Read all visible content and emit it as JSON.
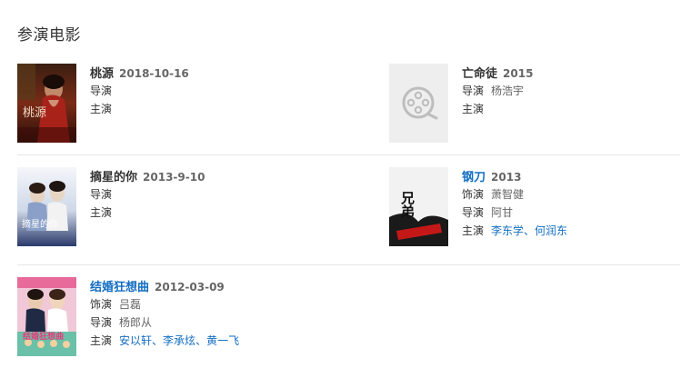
{
  "section_title": "参演电影",
  "movies": [
    {
      "title": "桃源",
      "date": "2018-10-16",
      "director_label": "导演",
      "starring_label": "主演"
    },
    {
      "title": "亡命徒",
      "date": "2015",
      "director_label": "导演",
      "director": "杨浩宇",
      "starring_label": "主演"
    },
    {
      "title": "摘星的你",
      "date": "2013-9-10",
      "director_label": "导演",
      "starring_label": "主演"
    },
    {
      "title": "钢刀",
      "date": "2013",
      "role_label": "饰演",
      "role": "萧智健",
      "director_label": "导演",
      "director": "阿甘",
      "starring_label": "主演",
      "stars": [
        "李东学",
        "何润东"
      ]
    },
    {
      "title": "结婚狂想曲",
      "date": "2012-03-09",
      "role_label": "饰演",
      "role": "吕磊",
      "director_label": "导演",
      "director": "杨郎从",
      "starring_label": "主演",
      "stars": [
        "安以轩",
        "李承炫",
        "黄一飞"
      ]
    }
  ],
  "poster_texts": {
    "taoyuan": "桃源",
    "zhaixing": "摘星的你",
    "gangdao": "兄弟",
    "jiehun": "结婚狂想曲"
  },
  "separator": "、",
  "colors": {
    "link": "#136ec2",
    "label": "#333333",
    "value": "#666666",
    "divider": "#e6e6e6",
    "placeholder_bg": "#eeeeee"
  },
  "icons": {
    "placeholder": "film-reel-icon"
  }
}
